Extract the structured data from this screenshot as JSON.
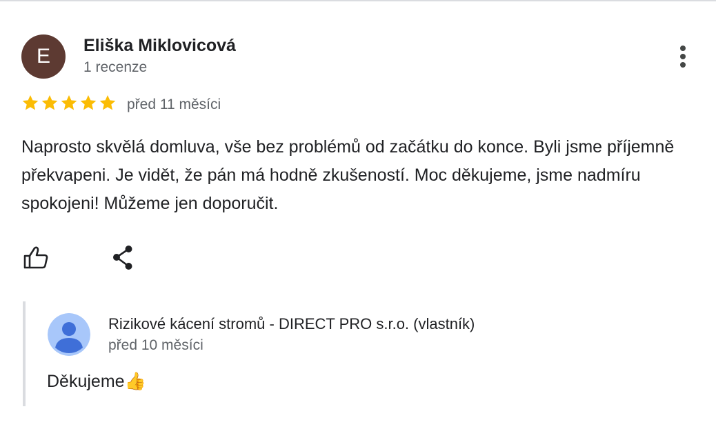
{
  "review": {
    "author": {
      "initial": "E",
      "name": "Eliška Miklovicová",
      "meta": "1 recenze",
      "avatar_color": "#5d3a32"
    },
    "rating": 5,
    "rating_max": 5,
    "star_color": "#fbbc04",
    "time": "před 11 měsíci",
    "text": "Naprosto skvělá domluva, vše bez problémů od začátku do konce. Byli jsme příjemně překvapeni. Je vidět, že pán má hodně zkušeností. Moc děkujeme, jsme nadmíru spokojeni! Můžeme jen doporučit.",
    "actions": {
      "like_icon": "thumbs-up-icon",
      "share_icon": "share-icon",
      "menu_icon": "more-vertical-icon"
    }
  },
  "owner_reply": {
    "name": "Rizikové kácení stromů - DIRECT PRO s.r.o. (vlastník)",
    "time": "před 10 měsíci",
    "text": "Děkujeme👍",
    "avatar_icon": "default-person-icon",
    "avatar_color": "#6b9cf5"
  },
  "colors": {
    "primary_text": "#202124",
    "secondary_text": "#5f6368",
    "divider": "#dadce0"
  }
}
